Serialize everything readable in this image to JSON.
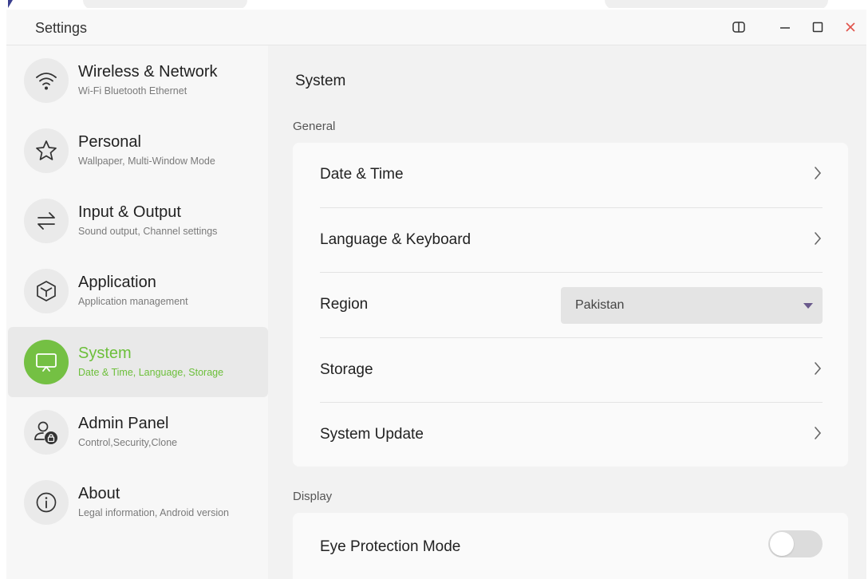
{
  "window": {
    "title": "Settings",
    "controls": [
      "split-icon",
      "minimize-icon",
      "maximize-icon",
      "close-icon"
    ],
    "close_color": "#e0524a"
  },
  "sidebar": {
    "items": [
      {
        "title": "Wireless & Network",
        "subtitle": "Wi-Fi Bluetooth Ethernet",
        "icon": "wifi-icon",
        "active": false
      },
      {
        "title": "Personal",
        "subtitle": "Wallpaper, Multi-Window Mode",
        "icon": "star-icon",
        "active": false
      },
      {
        "title": "Input & Output",
        "subtitle": "Sound output, Channel settings",
        "icon": "swap-arrows-icon",
        "active": false
      },
      {
        "title": "Application",
        "subtitle": "Application management",
        "icon": "cube-icon",
        "active": false
      },
      {
        "title": "System",
        "subtitle": "Date & Time, Language, Storage",
        "icon": "presentation-screen-icon",
        "active": true
      },
      {
        "title": "Admin Panel",
        "subtitle": "Control,Security,Clone",
        "icon": "user-lock-icon",
        "active": false
      },
      {
        "title": "About",
        "subtitle": "Legal information, Android version",
        "icon": "info-icon",
        "active": false
      }
    ],
    "accent_color": "#74c043"
  },
  "main": {
    "title": "System",
    "general": {
      "label": "General",
      "rows": {
        "date_time": "Date & Time",
        "language_keyboard": "Language & Keyboard",
        "region": "Region",
        "storage": "Storage",
        "system_update": "System Update"
      },
      "region_value": "Pakistan"
    },
    "display": {
      "label": "Display",
      "eye_protection": "Eye Protection Mode",
      "eye_protection_on": false
    }
  }
}
